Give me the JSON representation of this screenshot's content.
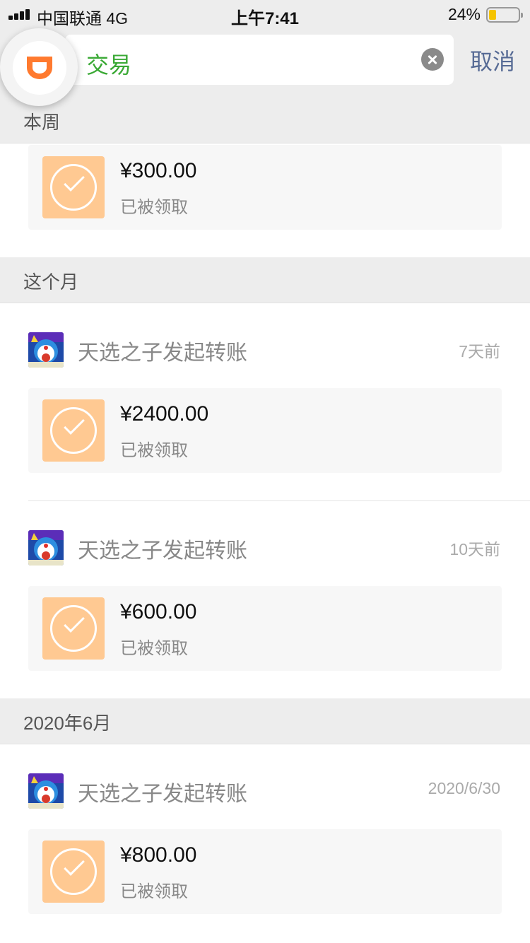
{
  "status_bar": {
    "carrier": "中国联通 4G",
    "time": "上午7:41",
    "battery": "24%"
  },
  "search": {
    "query": "交易",
    "cancel": "取消"
  },
  "sections": [
    {
      "title": "本周"
    },
    {
      "title": "这个月"
    },
    {
      "title": "2020年6月"
    }
  ],
  "entries": [
    {
      "title": "",
      "time": "",
      "amount": "¥300.00",
      "status": "已被领取"
    },
    {
      "title": "天选之子发起转账",
      "time": "7天前",
      "amount": "¥2400.00",
      "status": "已被领取"
    },
    {
      "title": "天选之子发起转账",
      "time": "10天前",
      "amount": "¥600.00",
      "status": "已被领取"
    },
    {
      "title": "天选之子发起转账",
      "time": "2020/6/30",
      "amount": "¥800.00",
      "status": "已被领取"
    }
  ],
  "colors": {
    "accent_green": "#3aa935",
    "link_blue": "#576b95",
    "card_icon": "#ffc992",
    "logo_orange": "#ff7a2f"
  }
}
